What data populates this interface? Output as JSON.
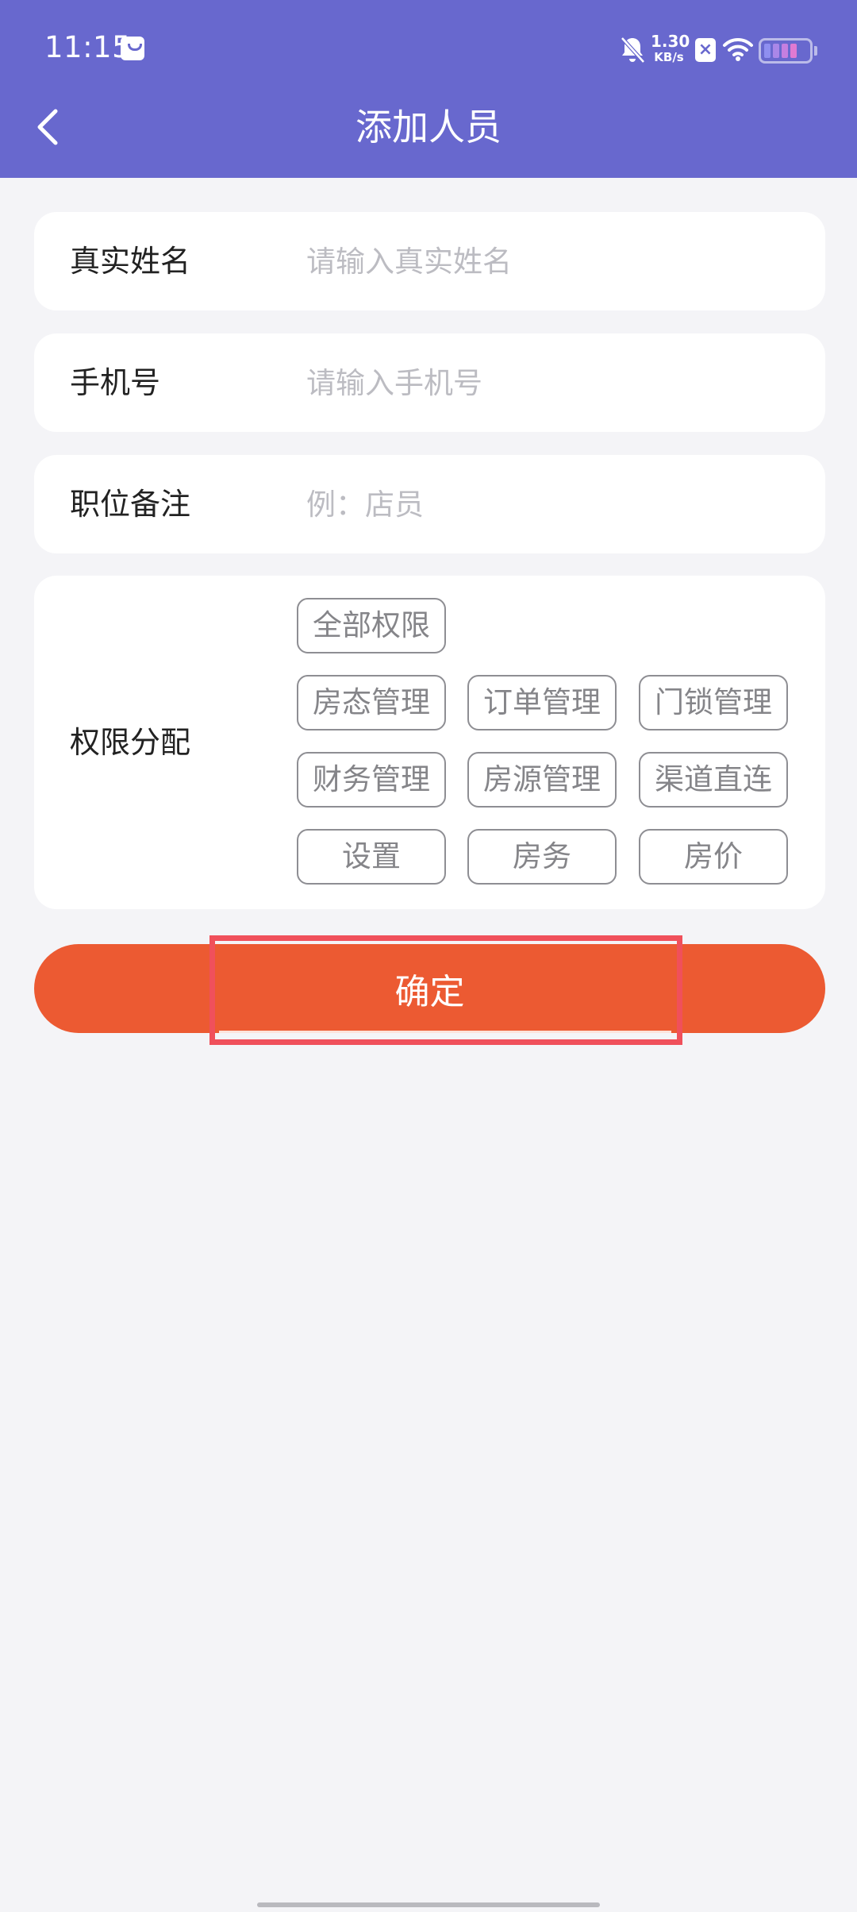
{
  "status_bar": {
    "time": "11:15",
    "net_speed_value": "1.30",
    "net_speed_unit": "KB/s",
    "battery_colors": [
      "#8F8FF0",
      "#A987E8",
      "#C57FE0",
      "#E07AD2"
    ]
  },
  "header": {
    "title": "添加人员",
    "background": "#6868CE"
  },
  "form": {
    "name": {
      "label": "真实姓名",
      "placeholder": "请输入真实姓名",
      "value": ""
    },
    "phone": {
      "label": "手机号",
      "placeholder": "请输入手机号",
      "value": ""
    },
    "position": {
      "label": "职位备注",
      "placeholder": "例：店员",
      "value": ""
    },
    "permissions": {
      "label": "权限分配",
      "options": [
        "全部权限",
        "房态管理",
        "订单管理",
        "门锁管理",
        "财务管理",
        "房源管理",
        "渠道直连",
        "设置",
        "房务",
        "房价"
      ]
    }
  },
  "confirm": {
    "label": "确定",
    "color": "#EC5A32",
    "highlighted": true
  },
  "icons": {
    "back": "chevron-left-icon",
    "bag": "shopping-bag-icon",
    "mute": "bell-off-icon",
    "wifi": "wifi-icon",
    "battery": "battery-icon"
  }
}
